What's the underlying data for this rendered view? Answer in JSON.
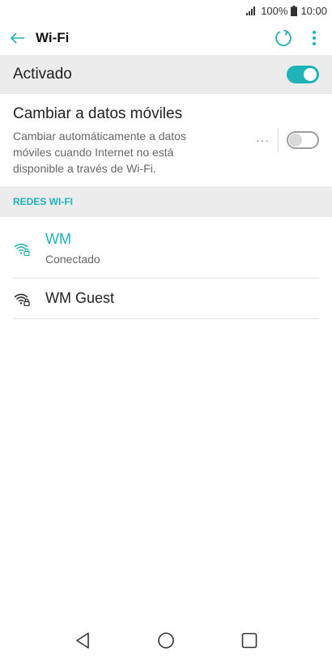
{
  "status_bar": {
    "battery_percent": "100%",
    "time": "10:00",
    "icons": [
      "signal-icon",
      "battery-icon"
    ]
  },
  "app_bar": {
    "title": "Wi-Fi",
    "icons": [
      "back-arrow-icon",
      "refresh-icon",
      "more-vert-icon"
    ]
  },
  "master_toggle": {
    "label": "Activado",
    "state": "on"
  },
  "switch_to_mobile": {
    "title": "Cambiar a datos móviles",
    "description": "Cambiar automáticamente a datos móviles cuando Internet no está disponible a través de Wi-Fi.",
    "more_label": "···",
    "state": "off"
  },
  "section": {
    "title": "REDES WI-FI"
  },
  "networks": [
    {
      "name": "WM",
      "status": "Conectado",
      "secured": true,
      "connected": true
    },
    {
      "name": "WM Guest",
      "secured": true,
      "connected": false
    }
  ],
  "colors": {
    "accent": "#1fb2b8",
    "section_bg": "#ececec"
  },
  "nav_bar": {
    "icons": [
      "back-triangle-icon",
      "home-circle-icon",
      "recents-square-icon"
    ]
  }
}
